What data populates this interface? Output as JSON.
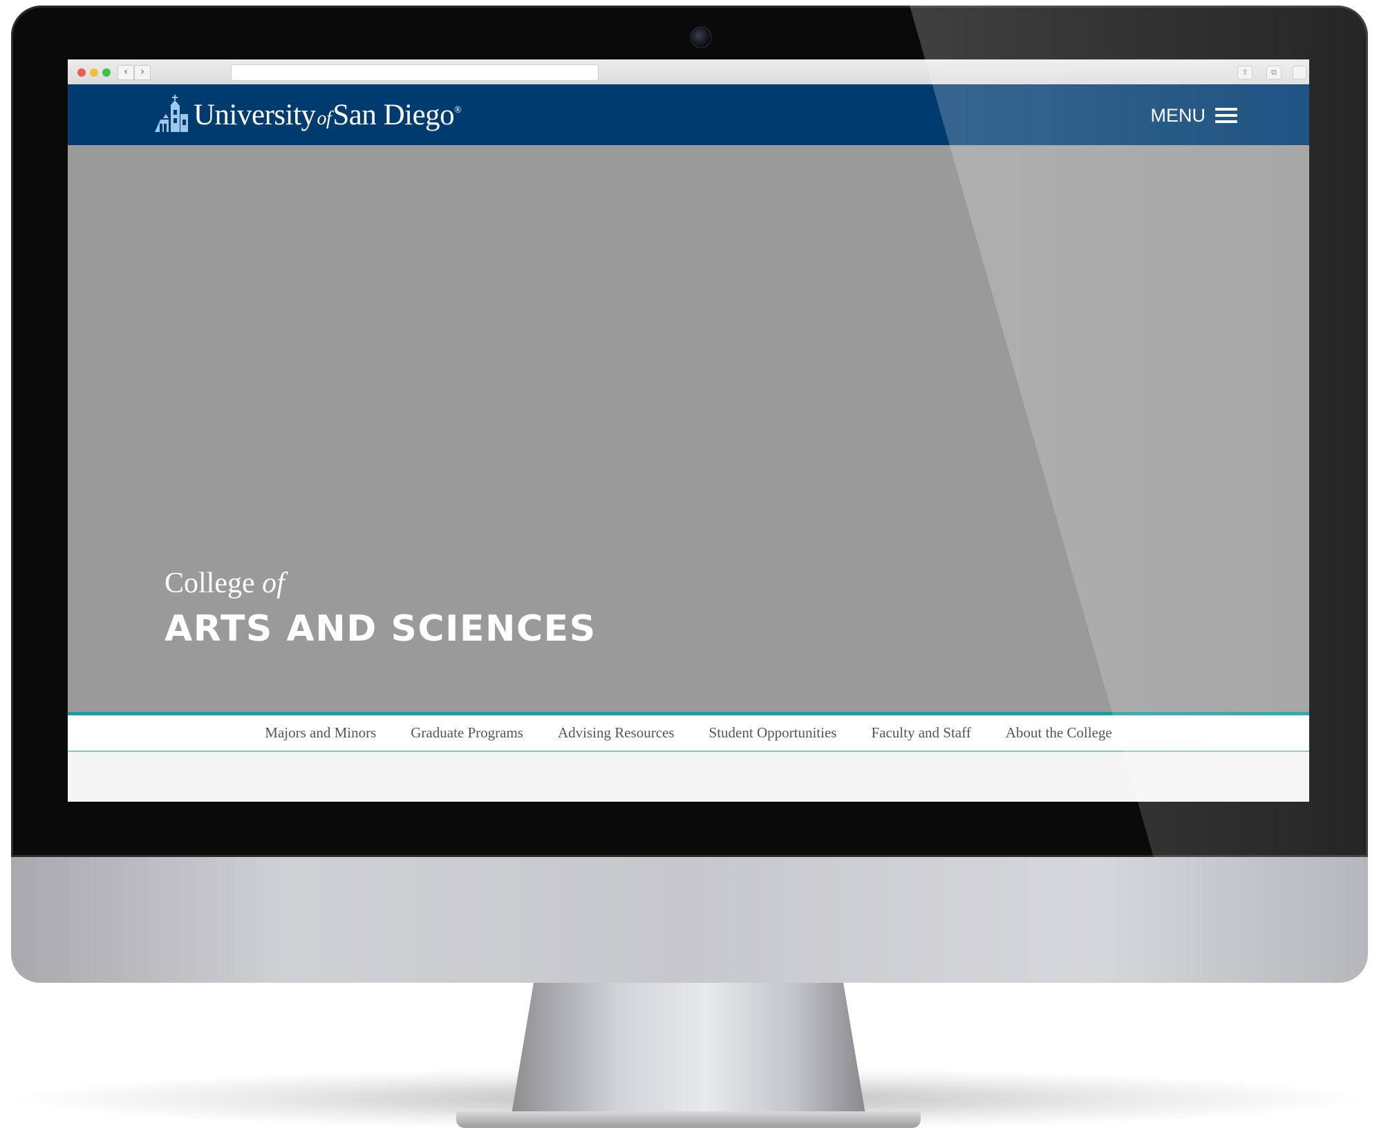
{
  "browser": {
    "back_icon": "‹",
    "forward_icon": "›"
  },
  "site_header": {
    "logo": {
      "university": "University",
      "of": "of",
      "san_diego": "San Diego",
      "reg_mark": "®"
    },
    "menu_label": "MENU",
    "brand_color": "#003b70"
  },
  "hero": {
    "college_prefix": "College ",
    "college_of": "of",
    "title": "ARTS AND SCIENCES",
    "background_color": "#9a9a9a"
  },
  "subnav": {
    "accent_color": "#12a0a0",
    "items": [
      {
        "label": "Majors and Minors"
      },
      {
        "label": "Graduate Programs"
      },
      {
        "label": "Advising Resources"
      },
      {
        "label": "Student Opportunities"
      },
      {
        "label": "Faculty and Staff"
      },
      {
        "label": "About the College"
      }
    ]
  }
}
